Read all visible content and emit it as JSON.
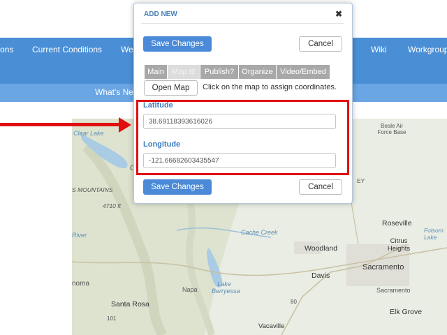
{
  "nav": {
    "items": [
      "ons",
      "Current Conditions",
      "We",
      "Wiki",
      "Workgroup"
    ],
    "subnav": "What's New"
  },
  "map": {
    "labels": [
      "Clear Lake",
      "Beale Air Force Base",
      "S MOUNTAINS",
      "4710 ft",
      "Cache Creek",
      "Roseville",
      "Folsom Lake",
      "Citrus Heights",
      "Woodland",
      "Sacramento",
      "Davis",
      "Lake Berryessa",
      "Napa",
      "Sacramento",
      "Santa Rosa",
      "Elk Grove",
      "Vacaville",
      "noma",
      "C",
      "EY",
      "River",
      "101",
      "80"
    ]
  },
  "dialog": {
    "title": "ADD NEW",
    "close_glyph": "✖",
    "save_label": "Save Changes",
    "cancel_label": "Cancel",
    "tabs": [
      "Main",
      "Map It!",
      "Publish?",
      "Organize",
      "Video/Embed"
    ],
    "active_tab": "Map It!",
    "open_map_label": "Open Map",
    "hint": "Click on the map to assign coordinates.",
    "latitude_label": "Latitude",
    "latitude_value": "38.69118393616026",
    "longitude_label": "Longitude",
    "longitude_value": "-121.66682603435547"
  },
  "colors": {
    "nav": "#4a8fd6",
    "highlight": "#e01010",
    "accent": "#4a8ad8"
  }
}
